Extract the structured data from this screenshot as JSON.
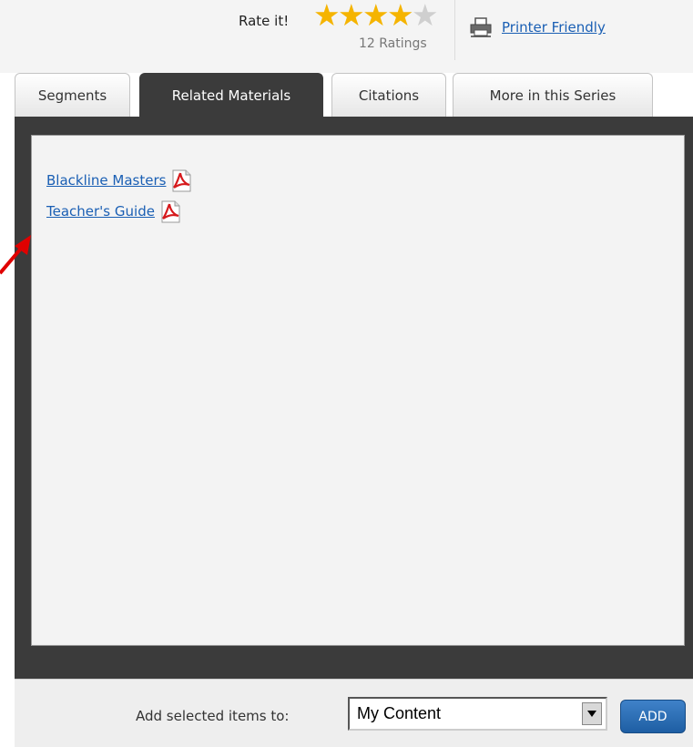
{
  "rating": {
    "label": "Rate it!",
    "stars_filled": 4,
    "stars_total": 5,
    "count_text": "12 Ratings"
  },
  "printer": {
    "label": "Printer Friendly",
    "icon": "printer-icon"
  },
  "tabs": [
    {
      "label": "Segments",
      "active": false
    },
    {
      "label": "Related Materials",
      "active": true
    },
    {
      "label": "Citations",
      "active": false
    },
    {
      "label": "More in this Series",
      "active": false
    }
  ],
  "materials": [
    {
      "label": "Blackline Masters",
      "icon": "pdf-icon"
    },
    {
      "label": "Teacher's Guide",
      "icon": "pdf-icon"
    }
  ],
  "footer": {
    "add_label": "Add selected items to:",
    "select_value": "My Content",
    "add_button": "ADD"
  },
  "colors": {
    "star": "#f5b400",
    "link": "#1a5fb4",
    "panel": "#3b3b3b",
    "annotation_arrow": "#e00000"
  }
}
